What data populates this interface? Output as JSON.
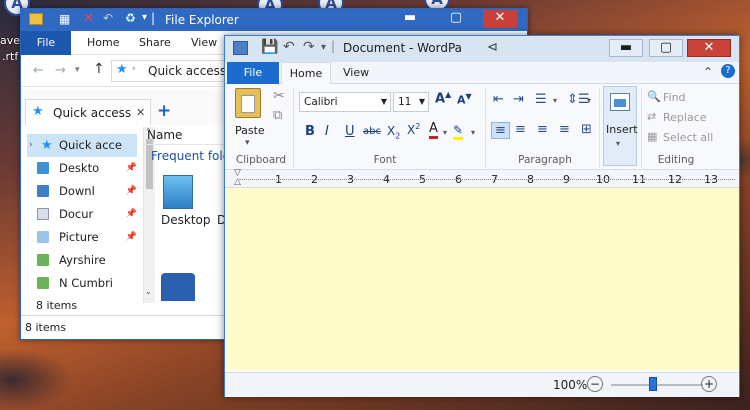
{
  "desktop": {
    "left_labels": [
      "ave",
      ".rtf"
    ]
  },
  "explorer": {
    "title": "File Explorer",
    "tabs": [
      "File",
      "Home",
      "Share",
      "View"
    ],
    "address": "Quick access",
    "open_tab": "Quick access",
    "new_tab": "+",
    "nav_items": [
      {
        "label": "Quick acce",
        "pinned": false,
        "selected": true
      },
      {
        "label": "Deskto",
        "pinned": true
      },
      {
        "label": "Downl",
        "pinned": true
      },
      {
        "label": "Docur",
        "pinned": true
      },
      {
        "label": "Picture",
        "pinned": true
      },
      {
        "label": "Ayrshire",
        "pinned": false
      },
      {
        "label": "N Cumbri",
        "pinned": false
      }
    ],
    "column_name": "Name",
    "section_label": "Frequent folde",
    "folders": [
      "Desktop",
      "D"
    ],
    "status_inner": "8 items",
    "status_outer": "8 items"
  },
  "wordpad": {
    "title": "Document - WordPa",
    "tabs": [
      "File",
      "Home",
      "View"
    ],
    "clipboard": {
      "paste": "Paste",
      "label": "Clipboard"
    },
    "font": {
      "name": "Calibri",
      "size": "11",
      "label": "Font"
    },
    "paragraph_label": "Paragraph",
    "insert_label": "Insert",
    "editing": {
      "find": "Find",
      "replace": "Replace",
      "select_all": "Select all",
      "label": "Editing"
    },
    "ruler_numbers": [
      "1",
      "2",
      "3",
      "4",
      "5",
      "6",
      "7",
      "8",
      "9",
      "10",
      "11",
      "12",
      "13"
    ],
    "zoom": "100%",
    "zoom_out": "−",
    "zoom_in": "+",
    "doc_bg": "#fffcc9"
  }
}
